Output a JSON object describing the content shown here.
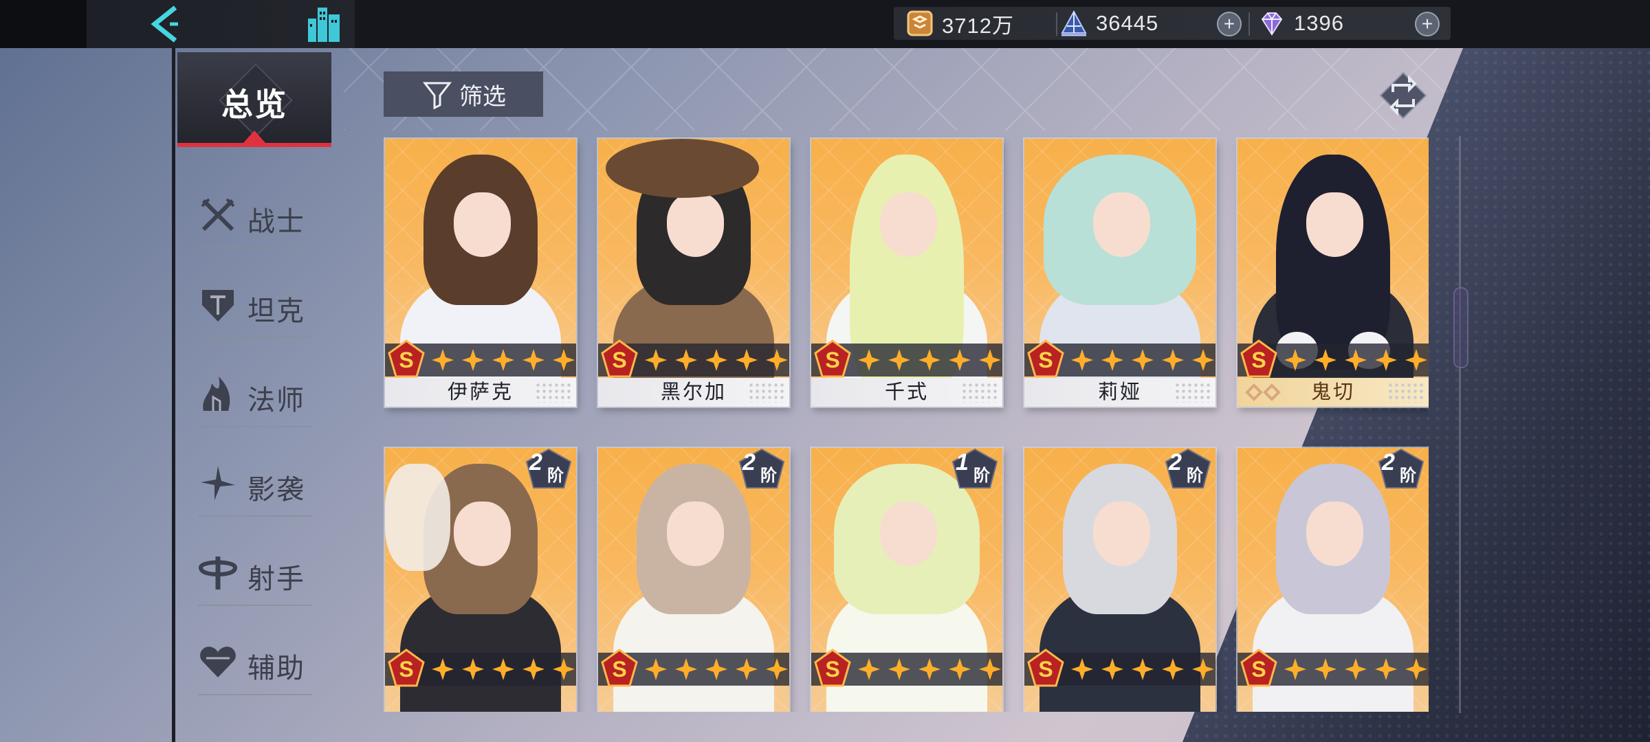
{
  "topbar": {
    "resources": [
      {
        "name": "gold-coin",
        "value": "3712万"
      },
      {
        "name": "stamina-crystal",
        "value": "36445"
      },
      {
        "name": "diamond",
        "value": "1396"
      }
    ]
  },
  "sidebar": {
    "overview_label": "总览",
    "items": [
      {
        "label": "战士",
        "icon": "crossed-swords-icon"
      },
      {
        "label": "坦克",
        "icon": "shield-icon"
      },
      {
        "label": "法师",
        "icon": "magic-icon"
      },
      {
        "label": "影袭",
        "icon": "shuriken-icon"
      },
      {
        "label": "射手",
        "icon": "crosshair-icon"
      },
      {
        "label": "辅助",
        "icon": "heart-icon"
      }
    ]
  },
  "toolbar": {
    "filter_label": "筛选"
  },
  "colors": {
    "accent": "#e0323e",
    "card_bg": "#f7b04a",
    "topbar": "#15171c"
  },
  "cards": [
    {
      "name": "伊萨克",
      "grade": "S",
      "stars": 5
    },
    {
      "name": "黑尔加",
      "grade": "S",
      "stars": 5
    },
    {
      "name": "千式",
      "grade": "S",
      "stars": 5
    },
    {
      "name": "莉娅",
      "grade": "S",
      "stars": 5
    },
    {
      "name": "鬼切",
      "grade": "S",
      "stars": 5
    },
    {
      "grade": "S",
      "rank": "2",
      "rank_suffix": "阶"
    },
    {
      "grade": "S",
      "rank": "2",
      "rank_suffix": "阶"
    },
    {
      "grade": "S",
      "rank": "1",
      "rank_suffix": "阶"
    },
    {
      "grade": "S",
      "rank": "2",
      "rank_suffix": "阶"
    },
    {
      "grade": "S",
      "rank": "2",
      "rank_suffix": "阶"
    }
  ]
}
